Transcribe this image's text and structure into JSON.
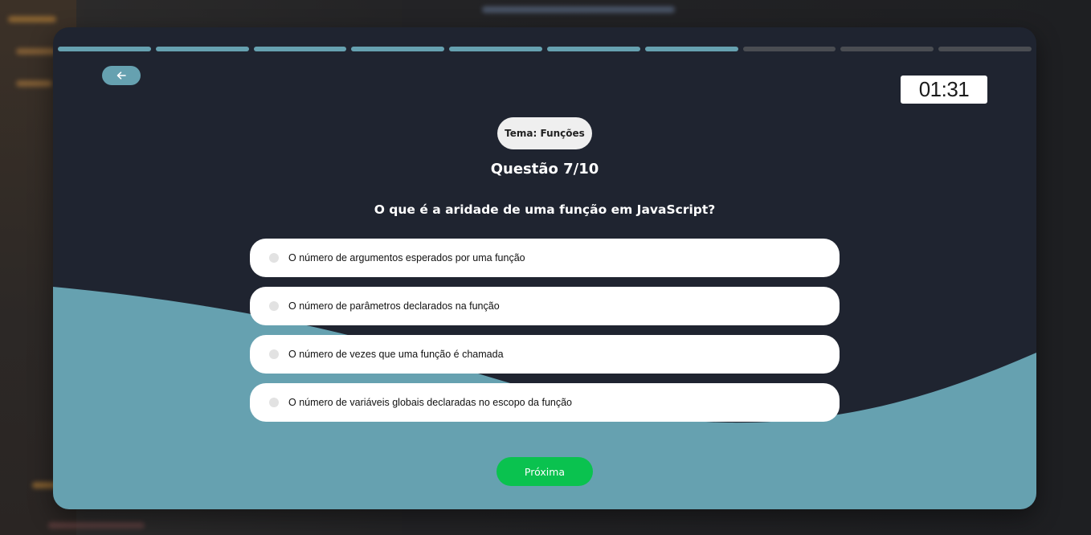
{
  "quiz": {
    "progress": {
      "current": 7,
      "total": 10
    },
    "timer": "01:31",
    "theme": "Tema: Funções",
    "question_number": "Questão 7/10",
    "question": "O que é a aridade de uma função em JavaScript?",
    "options": [
      "O número de argumentos esperados por uma função",
      "O número de parâmetros declarados na função",
      "O número de vezes que uma função é chamada",
      "O número de variáveis globais declaradas no escopo da função"
    ],
    "next_label": "Próxima"
  },
  "colors": {
    "accent": "#66a1b0",
    "card_bg": "#1f2430",
    "next": "#0ac24f"
  },
  "icons": {
    "back": "arrow-left-icon"
  }
}
